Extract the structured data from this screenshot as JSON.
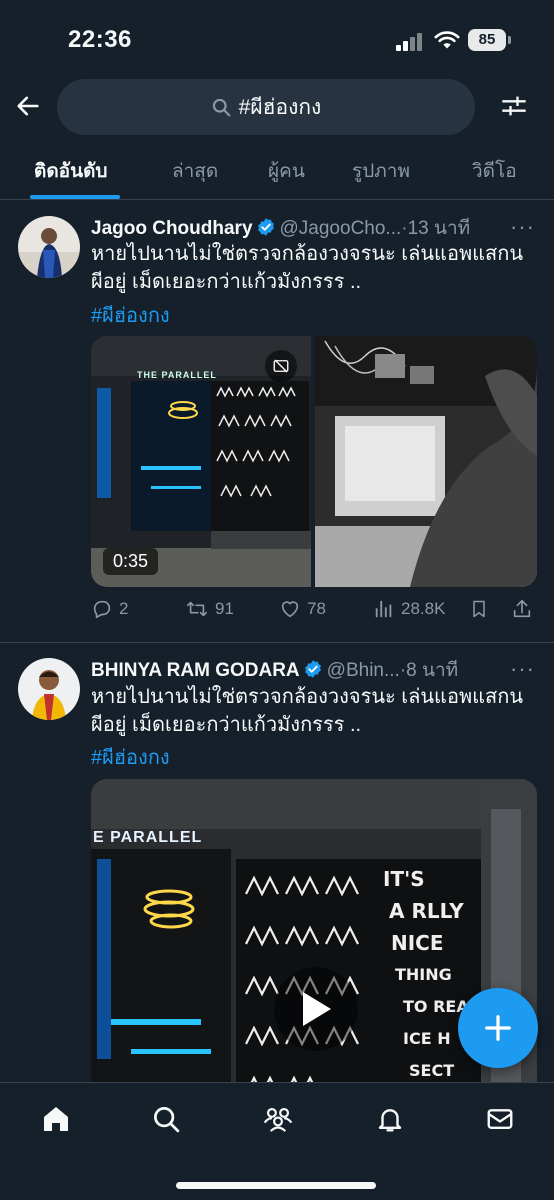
{
  "status_bar": {
    "time": "22:36",
    "battery": "85"
  },
  "search": {
    "query": "#ผีฮ่องกง"
  },
  "tabs": [
    {
      "label": "ติดอันดับ",
      "active": true
    },
    {
      "label": "ล่าสุด",
      "active": false
    },
    {
      "label": "ผู้คน",
      "active": false
    },
    {
      "label": "รูปภาพ",
      "active": false
    },
    {
      "label": "วิดีโอ",
      "active": false
    }
  ],
  "tweets": [
    {
      "name": "Jagoo Choudhary",
      "handle": "@JagooCho...",
      "dot": "·",
      "time": "13 นาที",
      "more": "···",
      "text": "หายไปนานไม่ใช่ตรวจกล้องวงจรนะ เล่นแอพแสกนผีอยู่ เม็ดเยอะกว่าแก้วมังกรรร ..",
      "hashtag": "#ผีฮ่องกง",
      "media": {
        "duration": "0:35",
        "sign_text": "THE PARALLEL"
      },
      "actions": {
        "replies": "2",
        "retweets": "91",
        "likes": "78",
        "views": "28.8K"
      }
    },
    {
      "name": "BHINYA RAM GODARA",
      "handle": "@Bhin...",
      "dot": "·",
      "time": "8 นาที",
      "more": "···",
      "text": "หายไปนานไม่ใช่ตรวจกล้องวงจรนะ เล่นแอพแสกนผีอยู่ เม็ดเยอะกว่าแก้วมังกรรร ..",
      "hashtag": "#ผีฮ่องกง",
      "media": {
        "sign_text": "E PARALLEL",
        "wall_text": [
          "IT'S",
          "A RLLY",
          "NICE",
          "THING",
          "TO REA",
          "ICE H",
          "SECT"
        ]
      }
    }
  ],
  "colors": {
    "background": "#15202b",
    "accent": "#1d9bf0",
    "muted": "#8b98a5",
    "divider": "#38444d"
  },
  "icons": {
    "back": "arrow-left-icon",
    "search": "search-icon",
    "filter": "sliders-icon",
    "verified": "verified-badge-icon",
    "reply": "reply-icon",
    "retweet": "retweet-icon",
    "like": "heart-icon",
    "views": "views-icon",
    "bookmark": "bookmark-icon",
    "share": "share-icon",
    "compose": "plus-icon",
    "home": "home-icon",
    "explore": "search-icon",
    "communities": "communities-icon",
    "notifications": "bell-icon",
    "messages": "mail-icon"
  }
}
